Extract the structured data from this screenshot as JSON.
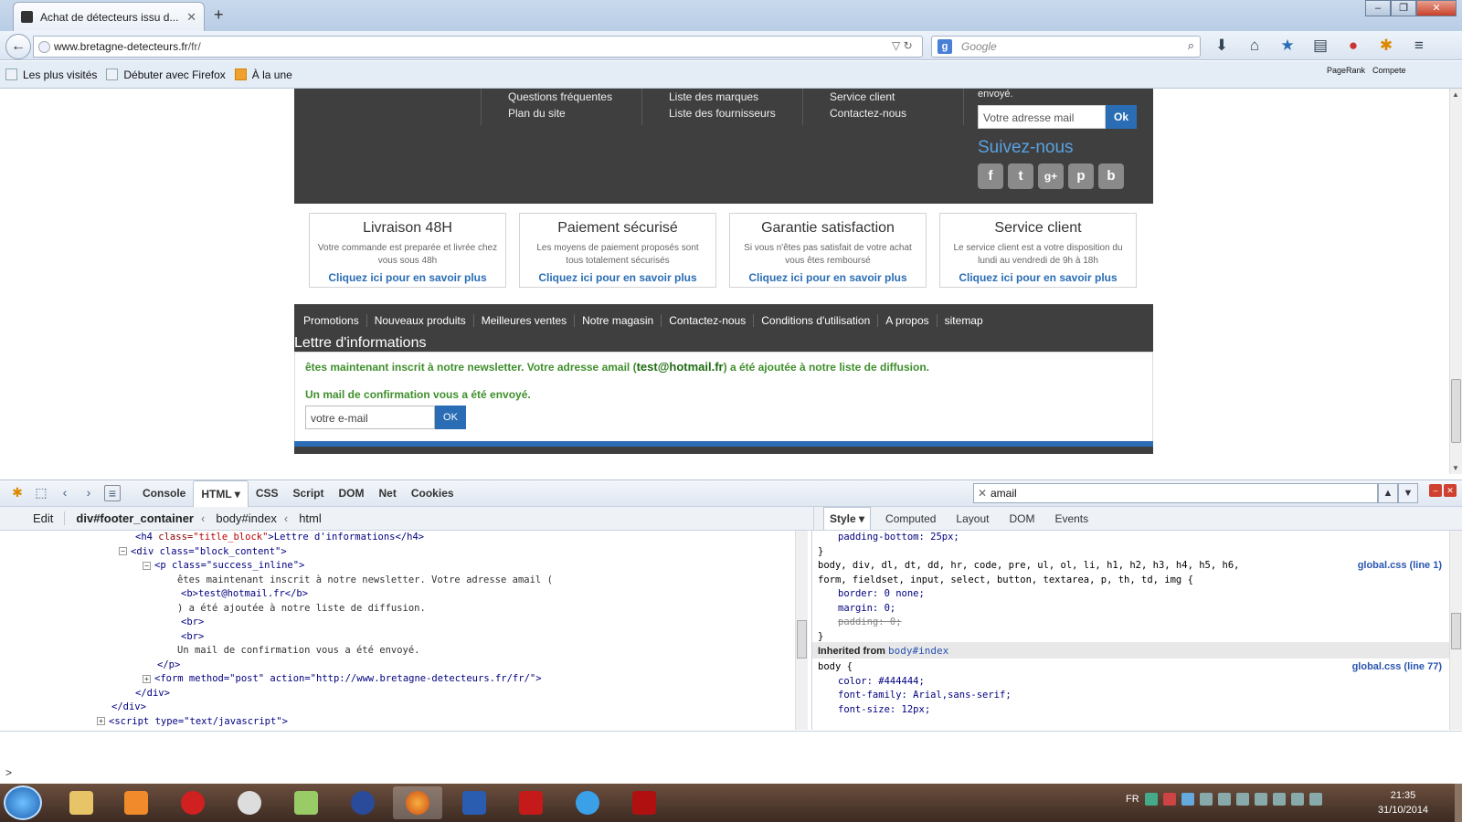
{
  "browser": {
    "tab_title": "Achat de détecteurs issu d...",
    "new_tab": "+",
    "url_host": "www.bretagne-detecteurs.fr",
    "url_path": "/fr/",
    "search_placeholder": "Google",
    "window_controls": [
      "–",
      "❐",
      "✕"
    ],
    "bookmarks": [
      "Les plus visités",
      "Débuter avec Firefox",
      "À la une"
    ],
    "right_addons": [
      "PageRank",
      "Compete"
    ]
  },
  "page": {
    "footer_links": {
      "col1": [
        "Questions fréquentes",
        "Plan du site"
      ],
      "col2": [
        "Liste des marques",
        "Liste des fournisseurs"
      ],
      "col3": [
        "Service client",
        "Contactez-nous"
      ]
    },
    "newsletter_snippet": "envoyé.",
    "newsletter_placeholder": "Votre adresse mail",
    "newsletter_ok": "Ok",
    "follow_title": "Suivez-nous",
    "social": [
      "f",
      "t",
      "g+",
      "p",
      "b"
    ],
    "features": [
      {
        "title": "Livraison 48H",
        "desc": "Votre commande est preparée et livrée chez vous sous 48h",
        "link": "Cliquez ici pour en savoir plus"
      },
      {
        "title": "Paiement sécurisé",
        "desc": "Les moyens de paiement proposés sont tous totalement sécurisés",
        "link": "Cliquez ici pour en savoir plus"
      },
      {
        "title": "Garantie satisfaction",
        "desc": "Si vous n'êtes pas satisfait de votre achat vous êtes remboursé",
        "link": "Cliquez ici pour en savoir plus"
      },
      {
        "title": "Service client",
        "desc": "Le service client est a votre disposition du lundi au vendredi de 9h à 18h",
        "link": "Cliquez ici pour en savoir plus"
      }
    ],
    "menu": [
      "Promotions",
      "Nouveaux produits",
      "Meilleures ventes",
      "Notre magasin",
      "Contactez-nous",
      "Conditions d'utilisation",
      "A propos",
      "sitemap"
    ],
    "lettre_title": "Lettre d'informations",
    "success_pre": "êtes maintenant inscrit à notre newsletter. Votre adresse amail (",
    "success_email": "test@hotmail.fr",
    "success_post": ") a été ajoutée à notre liste de diffusion.",
    "success_2": "Un mail de confirmation vous a été envoyé.",
    "email_placeholder": "votre e-mail",
    "email_ok": "OK"
  },
  "firebug": {
    "tabs": [
      "Console",
      "HTML ▾",
      "CSS",
      "Script",
      "DOM",
      "Net",
      "Cookies"
    ],
    "search_value": "amail",
    "edit_label": "Edit",
    "breadcrumb": [
      "div#footer_container",
      "body#index",
      "html"
    ],
    "side_tabs": [
      "Style ▾",
      "Computed",
      "Layout",
      "DOM",
      "Events"
    ],
    "html_lines": {
      "l1_tag": "<h4",
      "l1_attr": " class=",
      "l1_val": "\"title_block\"",
      "l1_text": ">Lettre d'informations</h4>",
      "l2": "<div class=\"block_content\">",
      "l3": "<p class=\"success_inline\">",
      "l4": "êtes maintenant inscrit à notre newsletter. Votre adresse amail (",
      "l5": "<b>test@hotmail.fr</b>",
      "l6": ") a été ajoutée à notre liste de diffusion.",
      "l7": "<br>",
      "l8": "<br>",
      "l9": "Un mail de confirmation vous a été envoyé.",
      "l10": "</p>",
      "l11": "<form method=\"post\" action=\"http://www.bretagne-detecteurs.fr/fr/\">",
      "l12": "</div>",
      "l13": "</div>",
      "l14": "<script type=\"text/javascript\">"
    },
    "css_lines": {
      "c1": "padding-bottom: 25px;",
      "c2": "}",
      "c3": "body, div, dl, dt, dd, hr, code, pre, ul, ol, li, h1, h2, h3, h4, h5, h6,",
      "c4": "form, fieldset, input, select, button, textarea, p, th, td, img {",
      "c5": "border: 0 none;",
      "c6": "margin: 0;",
      "c7": "padding: 0;",
      "c8": "}",
      "src1": "global.css (line 1)",
      "inherited_label": "Inherited from",
      "inherited_link": "body#index",
      "c9": "body {",
      "src2": "global.css (line 77)",
      "c10": "color: #444444;",
      "c11": "font-family: Arial,sans-serif;",
      "c12": "font-size: 12px;"
    },
    "cmd_prompt": ">"
  },
  "taskbar": {
    "lang": "FR",
    "time": "21:35",
    "date": "31/10/2014"
  },
  "colors": {
    "footer_dark": "#3f3f3f",
    "accent_blue": "#2a6db5",
    "success_green": "#3f8f2c"
  }
}
